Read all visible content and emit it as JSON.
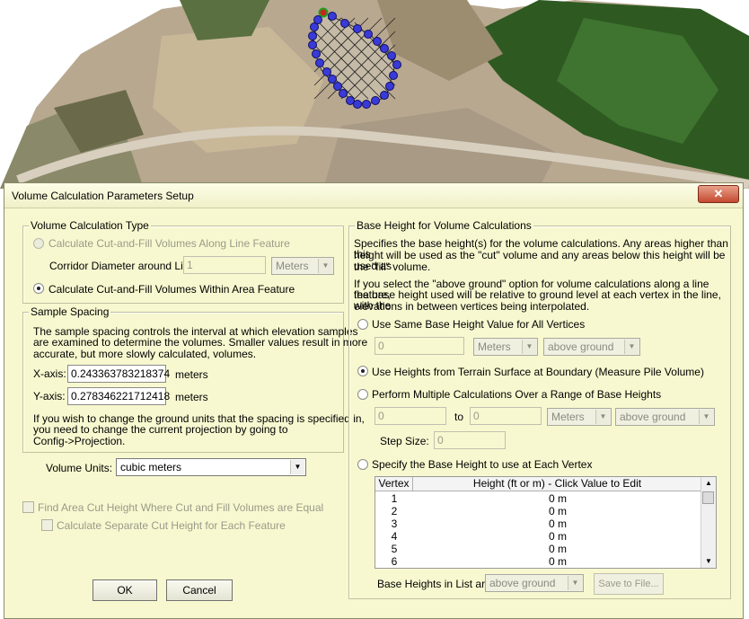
{
  "window": {
    "title": "Volume Calculation Parameters Setup",
    "close_label": "✕"
  },
  "calc_type": {
    "group_label": "Volume Calculation Type",
    "line_feature_label": "Calculate Cut-and-Fill Volumes Along Line Feature",
    "corridor_label": "Corridor Diameter around Line:",
    "corridor_value": "1",
    "corridor_units": "Meters",
    "area_feature_label": "Calculate Cut-and-Fill Volumes Within Area Feature"
  },
  "sample_spacing": {
    "group_label": "Sample Spacing",
    "desc_lines": [
      "The sample spacing controls the interval at which elevation samples",
      "are examined to determine the volumes. Smaller values result in more",
      "accurate, but more slowly calculated, volumes."
    ],
    "x_label": "X-axis:",
    "x_value": "0.243363783218374",
    "x_units": "meters",
    "y_label": "Y-axis:",
    "y_value": "0.278346221712418",
    "y_units": "meters",
    "note_lines": [
      "If you wish to change the ground units that the spacing is specified in,",
      "you need to change the current projection by going to",
      "Config->Projection."
    ]
  },
  "volume_units": {
    "label": "Volume Units:",
    "value": "cubic meters"
  },
  "cut_height": {
    "find_label": "Find Area Cut Height Where Cut and Fill Volumes are Equal",
    "separate_label": "Calculate Separate Cut Height for Each Feature"
  },
  "buttons": {
    "ok": "OK",
    "cancel": "Cancel"
  },
  "base_height": {
    "group_label": "Base Height for Volume Calculations",
    "desc1_lines": [
      "Specifies the base height(s) for the volume calculations. Any areas higher than this",
      "height will be used as the \"cut\" volume and any areas below this height will be used as",
      "the \"fill\" volume."
    ],
    "desc2_lines": [
      "If you select the \"above ground\" option for volume calculations along a line feature,",
      "the base height used will be relative to ground level at each vertex in the line, with the",
      "elevations in between vertices being interpolated."
    ],
    "same_label": "Use Same Base Height Value for All Vertices",
    "same_value": "0",
    "same_units": "Meters",
    "same_ref": "above ground",
    "terrain_label": "Use Heights from Terrain Surface at Boundary (Measure Pile Volume)",
    "multi_label": "Perform Multiple Calculations Over a Range of Base Heights",
    "multi_from": "0",
    "multi_to_label": "to",
    "multi_to": "0",
    "multi_units": "Meters",
    "multi_ref": "above ground",
    "step_label": "Step Size:",
    "step_value": "0",
    "vertex_label": "Specify the Base Height to use at Each Vertex",
    "table": {
      "col_vertex": "Vertex",
      "col_height": "Height (ft or m) - Click Value to Edit",
      "rows": [
        {
          "vertex": "1",
          "height": "0 m"
        },
        {
          "vertex": "2",
          "height": "0 m"
        },
        {
          "vertex": "3",
          "height": "0 m"
        },
        {
          "vertex": "4",
          "height": "0 m"
        },
        {
          "vertex": "5",
          "height": "0 m"
        },
        {
          "vertex": "6",
          "height": "0 m"
        }
      ]
    },
    "list_label": "Base Heights in List are",
    "list_ref": "above ground",
    "save_label": "Save to File..."
  }
}
